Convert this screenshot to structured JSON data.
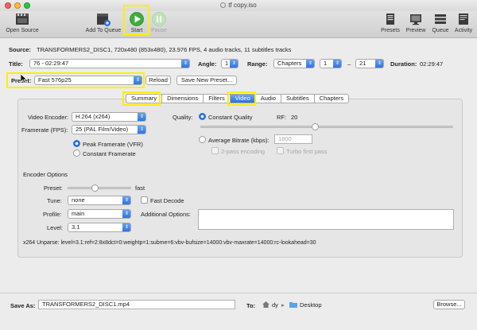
{
  "window": {
    "title": "tf copy.iso"
  },
  "toolbar": {
    "open_source": "Open Source",
    "add_to_queue": "Add To Queue",
    "start": "Start",
    "pause": "Pause",
    "presets": "Presets",
    "preview": "Preview",
    "queue": "Queue",
    "activity": "Activity"
  },
  "source": {
    "label": "Source:",
    "value": "TRANSFORMERS2_DISC1, 720x480 (853x480), 23.976 FPS, 4 audio tracks, 11 subtitles tracks"
  },
  "title_row": {
    "title_label": "Title:",
    "title_value": "76 - 02:29:47",
    "angle_label": "Angle:",
    "angle_value": "1",
    "range_label": "Range:",
    "range_type": "Chapters",
    "range_start": "1",
    "range_dash": "–",
    "range_end": "21",
    "duration_label": "Duration:",
    "duration_value": "02:29:47"
  },
  "preset_row": {
    "label": "Preset:",
    "value": "Fast 576p25",
    "reload": "Reload",
    "save_new": "Save New Preset..."
  },
  "tabs": [
    "Summary",
    "Dimensions",
    "Filters",
    "Video",
    "Audio",
    "Subtitles",
    "Chapters"
  ],
  "selected_tab": "Video",
  "video": {
    "encoder_label": "Video Encoder:",
    "encoder_value": "H.264 (x264)",
    "framerate_label": "Framerate (FPS):",
    "framerate_value": "25 (PAL Film/Video)",
    "peak_framerate": "Peak Framerate (VFR)",
    "constant_framerate": "Constant Framerate",
    "quality_label": "Quality:",
    "constant_quality": "Constant Quality",
    "rf_label": "RF:",
    "rf_value": "20",
    "average_bitrate": "Average Bitrate (kbps):",
    "bitrate_value": "1800",
    "two_pass": "2-pass encoding",
    "turbo_first": "Turbo first pass"
  },
  "encoder_options": {
    "heading": "Encoder Options",
    "preset_label": "Preset:",
    "preset_value": "fast",
    "tune_label": "Tune:",
    "tune_value": "none",
    "fast_decode": "Fast Decode",
    "profile_label": "Profile:",
    "profile_value": "main",
    "additional_label": "Additional Options:",
    "level_label": "Level:",
    "level_value": "3.1",
    "unparse": "x264 Unparse: level=3.1:ref=2:8x8dct=0:weightp=1:subme=6:vbv-bufsize=14000:vbv-maxrate=14000:rc-lookahead=30"
  },
  "save": {
    "label": "Save As:",
    "filename": "TRANSFORMERS2_DISC1.mp4",
    "to_label": "To:",
    "user": "dy",
    "folder": "Desktop",
    "browse": "Browse..."
  },
  "colors": {
    "highlight": "#ffef00",
    "accent_blue": "#2d6fe0",
    "start_green": "#3fae3a"
  }
}
